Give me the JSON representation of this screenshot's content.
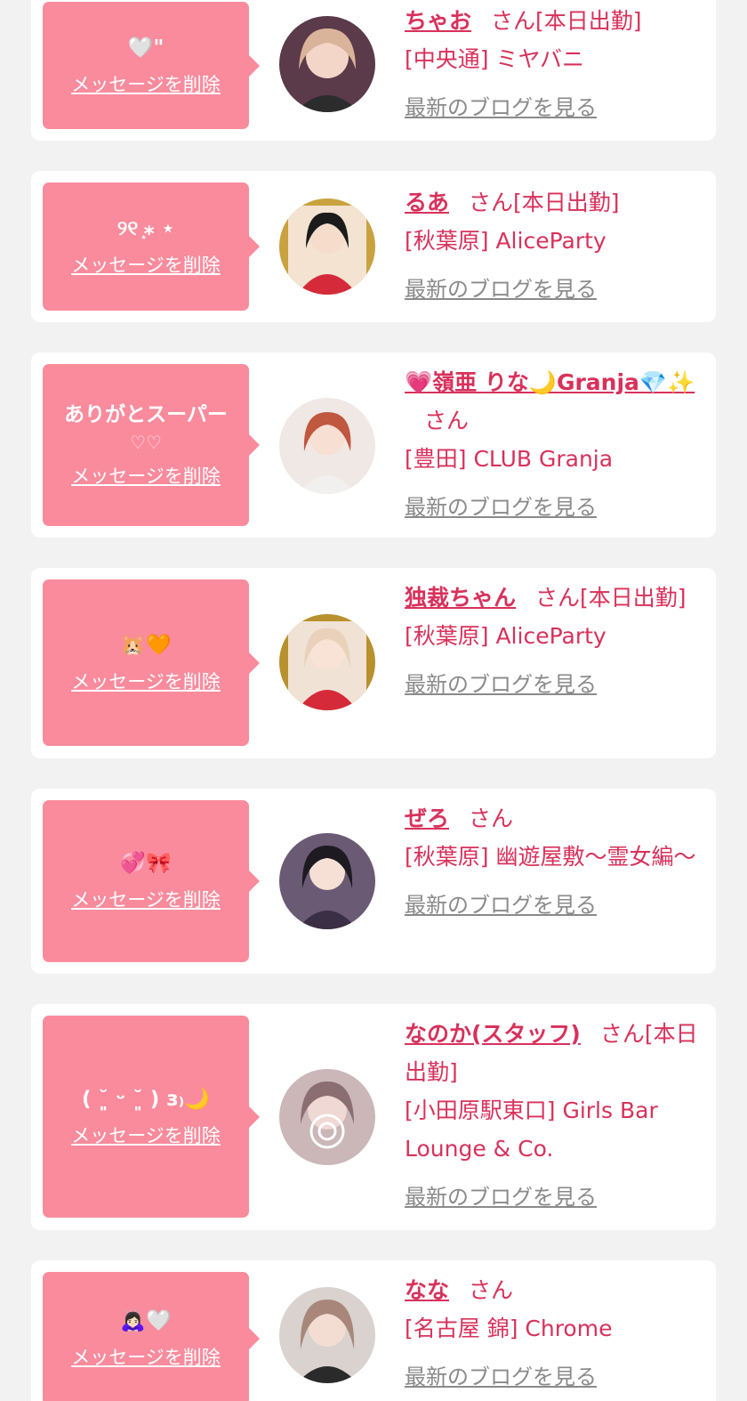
{
  "colors": {
    "page_bg": "#f2f2f2",
    "card_bg": "#ffffff",
    "bubble_bg": "#f98b9d",
    "accent": "#d8315b",
    "link_gray": "#8a8a8a"
  },
  "labels": {
    "delete_message": "メッセージを削除",
    "see_blog": "最新のブログを見る"
  },
  "items": [
    {
      "message": "🤍\"",
      "message2": "",
      "name": "ちゃお",
      "honorific": "さん",
      "status": "[本日出勤]",
      "shop": "[中央通] ミヤバニ",
      "avatar_icon": "girl-avatar-icon"
    },
    {
      "message": "୨୧ ͙⁎ ⋆",
      "message2": "",
      "name": "るあ",
      "honorific": "さん",
      "status": "[本日出勤]",
      "shop": "[秋葉原] AliceParty",
      "avatar_icon": "girl-avatar-icon"
    },
    {
      "message": "ありがとスーパー",
      "message2": "♡♡",
      "name": "💗嶺亜 りな🌙Granja💎✨",
      "honorific": "さん",
      "status": "",
      "shop": "[豊田] CLUB Granja",
      "avatar_icon": "girl-avatar-icon"
    },
    {
      "message": "🐹🧡",
      "message2": "",
      "name": "独裁ちゃん",
      "honorific": "さん",
      "status": "[本日出勤]",
      "shop": "[秋葉原] AliceParty",
      "avatar_icon": "girl-avatar-icon"
    },
    {
      "message": "💞🎀",
      "message2": "",
      "name": "ぜろ",
      "honorific": "さん",
      "status": "",
      "shop": "[秋葉原] 幽遊屋敷〜霊女編〜",
      "avatar_icon": "girl-avatar-icon"
    },
    {
      "message": "( ˘͈ ᵕ ˘͈ ) з₎🌙",
      "message2": "",
      "name": "なのか(スタッフ)",
      "honorific": "さん",
      "status": "[本日出勤]",
      "shop": "[小田原駅東口] Girls Bar Lounge & Co.",
      "avatar_icon": "girl-avatar-icon"
    },
    {
      "message": "🙇🏻‍♀️🤍",
      "message2": "",
      "name": "なな",
      "honorific": "さん",
      "status": "",
      "shop": "[名古屋 錦] Chrome",
      "avatar_icon": "girl-avatar-icon"
    }
  ]
}
